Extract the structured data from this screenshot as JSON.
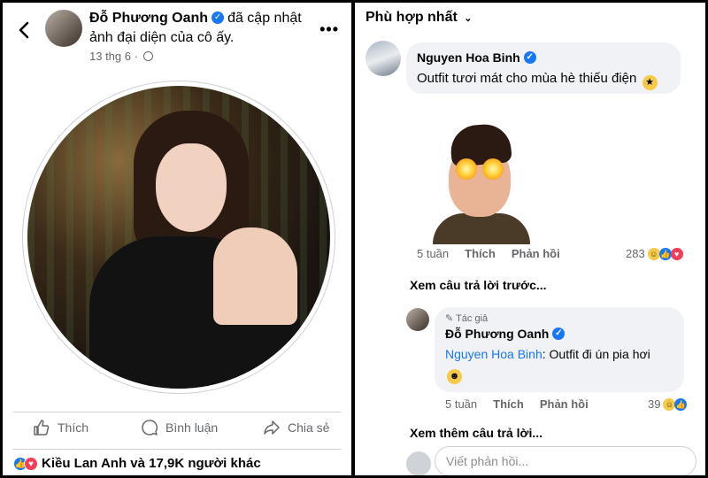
{
  "left": {
    "post": {
      "author": "Đỗ Phương Oanh",
      "action_text": "đã cập nhật ảnh đại diện của cô ấy.",
      "date": "13 thg 6 ·"
    },
    "actions": {
      "like": "Thích",
      "comment": "Bình luận",
      "share": "Chia sẻ"
    },
    "reactions_text": "Kiều Lan Anh và 17,9K người khác"
  },
  "right": {
    "sort_label": "Phù hợp nhất",
    "comment1": {
      "author": "Nguyen Hoa Binh",
      "text": "Outfit tươi mát cho mùa hè thiếu điện",
      "time": "5 tuần",
      "like": "Thích",
      "reply": "Phản hồi",
      "count": "283"
    },
    "view_previous": "Xem câu trả lời trước...",
    "comment2": {
      "tag": "Tác giả",
      "author": "Đỗ Phương Oanh",
      "mention": "Nguyen Hoa Binh",
      "text": ": Outfit đi ún pia hơi",
      "time": "5 tuần",
      "like": "Thích",
      "reply": "Phản hồi",
      "count": "39"
    },
    "view_more": "Xem thêm câu trả lời...",
    "reply_placeholder": "Viết phản hồi..."
  },
  "colors": {
    "accent": "#1877f2",
    "love": "#f33e58",
    "bubble": "#f0f2f5",
    "muted": "#65676b"
  }
}
